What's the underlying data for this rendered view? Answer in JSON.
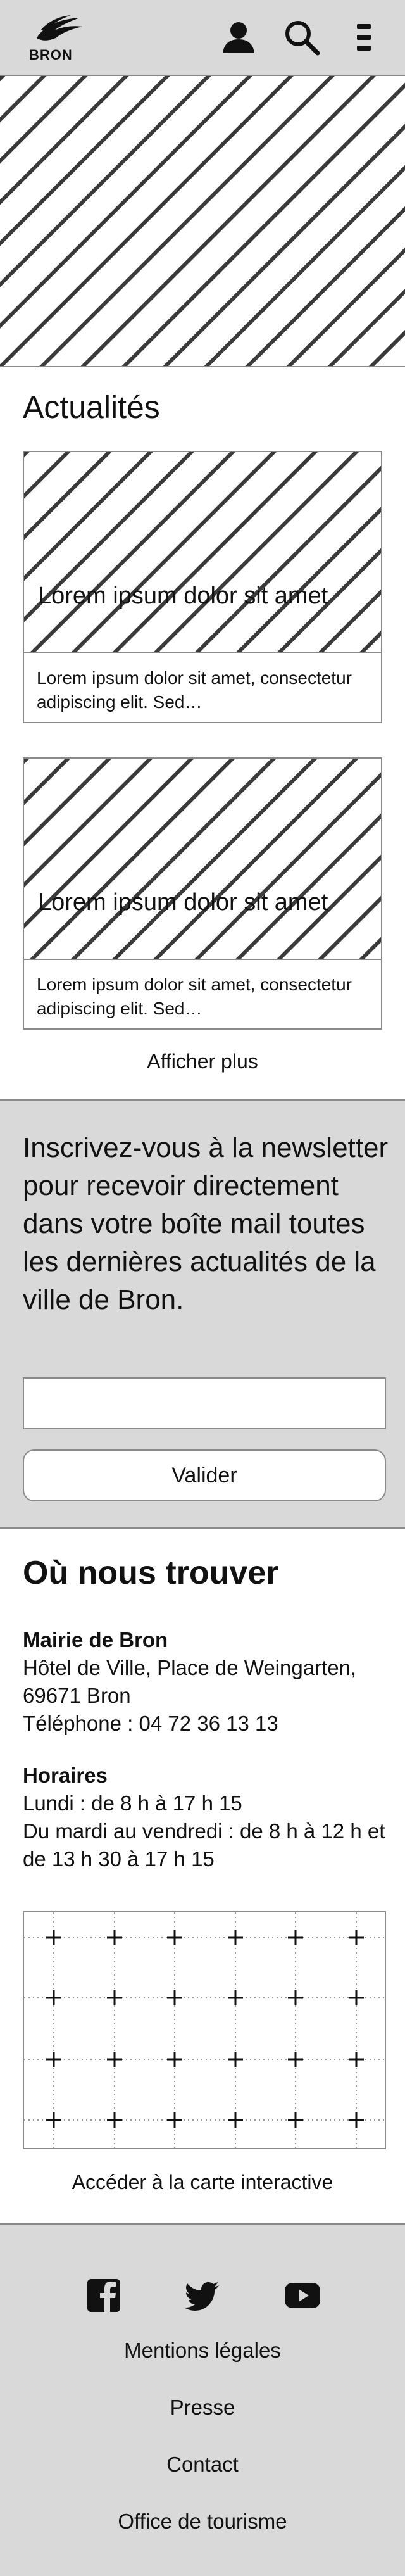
{
  "header": {
    "logo_text": "BRON",
    "icons": [
      "user-icon",
      "search-icon",
      "menu-icon"
    ]
  },
  "news": {
    "title": "Actualités",
    "cards": [
      {
        "title": "Lorem ipsum dolor sit amet",
        "text": "Lorem ipsum dolor sit amet, consectetur adipiscing elit. Sed…"
      },
      {
        "title": "Lorem ipsum dolor sit amet",
        "text": "Lorem ipsum dolor sit amet, consectetur adipiscing elit. Sed…"
      }
    ],
    "more_label": "Afficher plus"
  },
  "newsletter": {
    "text": "Inscrivez-vous à la newsletter pour recevoir directement dans votre boîte mail toutes les dernières actualités de la ville de Bron.",
    "input_value": "",
    "button_label": "Valider"
  },
  "location": {
    "title": "Où nous trouver",
    "place_name": "Mairie de Bron",
    "address": "Hôtel de Ville, Place de Weingarten, 69671 Bron",
    "phone": "Téléphone : 04 72 36 13 13",
    "hours_title": "Horaires",
    "hours_monday": "Lundi : de 8 h à 17 h 15",
    "hours_weekdays": "Du mardi au vendredi : de 8 h à 12 h et de 13 h 30 à 17 h 15",
    "map_link": "Accéder à la carte interactive"
  },
  "footer": {
    "social_icons": [
      "facebook-icon",
      "twitter-icon",
      "youtube-icon"
    ],
    "links": [
      "Mentions légales",
      "Presse",
      "Contact",
      "Office de tourisme"
    ]
  },
  "colors": {
    "panel_gray": "#d9d9d9",
    "border_gray": "#8a8a8a",
    "text": "#111111"
  }
}
